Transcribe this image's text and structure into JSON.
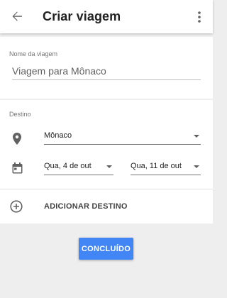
{
  "appbar": {
    "title": "Criar viagem",
    "back_icon": "arrow-back-icon",
    "more_icon": "more-vert-icon"
  },
  "trip_name": {
    "label": "Nome da viagem",
    "value": "Viagem para Mônaco"
  },
  "destination": {
    "label": "Destino",
    "place_icon": "location-pin-icon",
    "place_value": "Mônaco",
    "calendar_icon": "calendar-icon",
    "start_date": "Qua, 4 de out",
    "end_date": "Qua, 11 de out"
  },
  "add_destination": {
    "icon": "add-circle-icon",
    "label": "ADICIONAR DESTINO"
  },
  "done_button": {
    "label": "CONCLUÍDO"
  },
  "colors": {
    "accent": "#4285f4",
    "background": "#eeeeee",
    "card": "#ffffff",
    "text_primary": "#212121",
    "icon": "#616161"
  }
}
